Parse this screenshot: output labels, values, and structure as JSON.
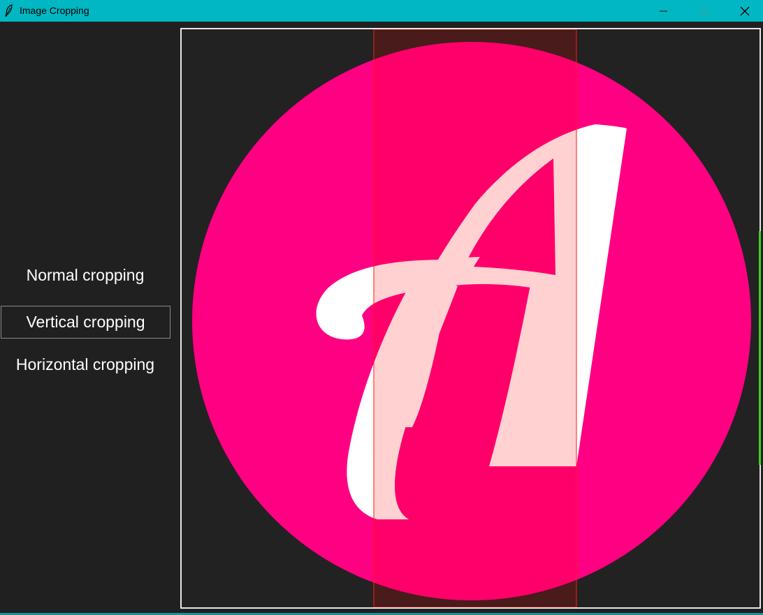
{
  "window": {
    "title": "Image Cropping",
    "icon": "feather-icon",
    "controls": [
      "minimize-icon",
      "maximize-icon",
      "close-icon"
    ],
    "titlebar_color": "#00b7c3"
  },
  "sidebar": {
    "buttons": [
      {
        "label": "Normal cropping",
        "selected": false
      },
      {
        "label": "Vertical cropping",
        "selected": true
      },
      {
        "label": "Horizontal cropping",
        "selected": false
      }
    ]
  },
  "canvas": {
    "image": "pink-circle-letter-A-logo",
    "logo_letter": "A",
    "logo_circle_color": "#ff0083",
    "logo_letter_color": "#ffffff",
    "crop_overlay_color": "#ff0000",
    "crop_mode": "vertical",
    "scroll_indicator_color": "#3ed61c"
  }
}
